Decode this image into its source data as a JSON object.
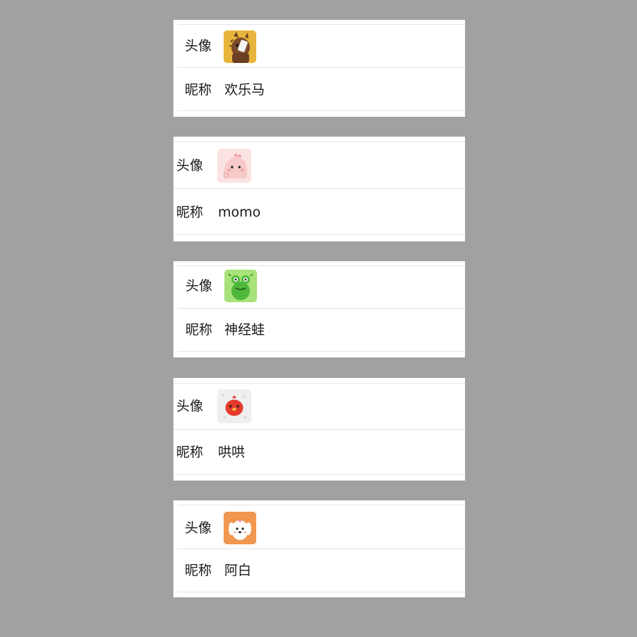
{
  "profiles": [
    {
      "avatar_label": "头像",
      "avatar_icon": "horse-avatar-icon",
      "avatar_bg": "#e8b53c",
      "nickname_label": "昵称",
      "nickname": "欢乐马"
    },
    {
      "avatar_label": "头像",
      "avatar_icon": "pink-monster-avatar-icon",
      "avatar_bg": "#f9dcdc",
      "nickname_label": "昵称",
      "nickname": "momo"
    },
    {
      "avatar_label": "头像",
      "avatar_icon": "frog-avatar-icon",
      "avatar_bg": "#9ee06e",
      "nickname_label": "昵称",
      "nickname": "神经蛙"
    },
    {
      "avatar_label": "头像",
      "avatar_icon": "red-chick-avatar-icon",
      "avatar_bg": "#ededed",
      "nickname_label": "昵称",
      "nickname": "哄哄"
    },
    {
      "avatar_label": "头像",
      "avatar_icon": "white-dog-avatar-icon",
      "avatar_bg": "#f0954a",
      "nickname_label": "昵称",
      "nickname": "阿白"
    }
  ]
}
